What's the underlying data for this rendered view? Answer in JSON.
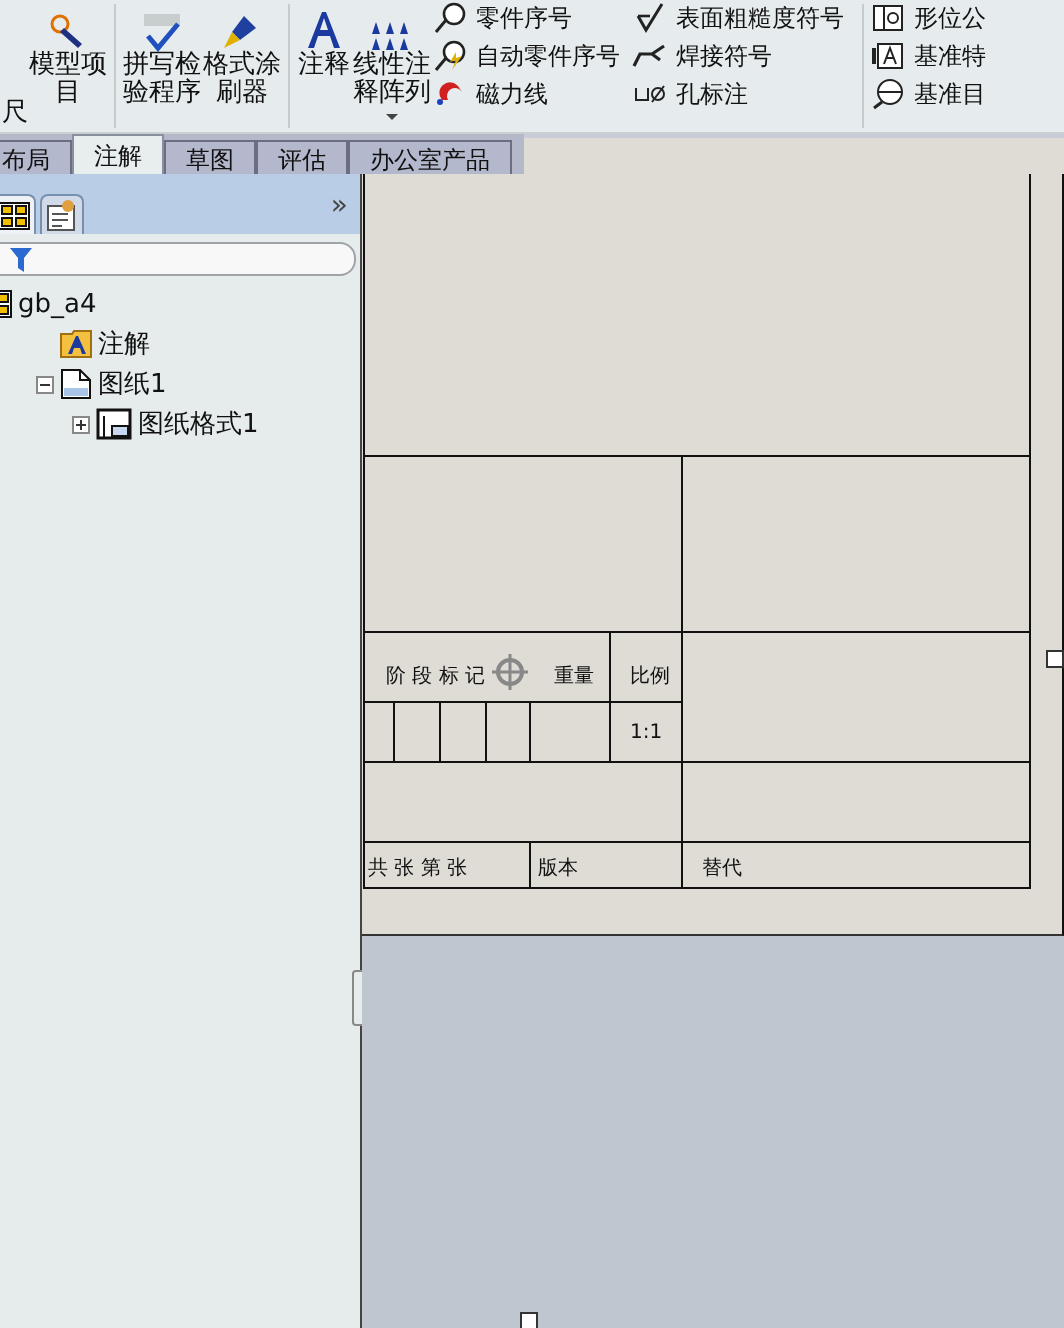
{
  "ribbon": [
    {
      "kind": "large",
      "label": "尺",
      "has_menu": false
    },
    {
      "kind": "large",
      "label": "模型项目",
      "has_menu": false
    },
    {
      "kind": "separator"
    },
    {
      "kind": "large",
      "label": "拼写检验程序",
      "has_menu": false
    },
    {
      "kind": "large",
      "label": "格式涂刷器",
      "has_menu": false
    },
    {
      "kind": "separator"
    },
    {
      "kind": "large",
      "label": "注释",
      "has_menu": false
    },
    {
      "kind": "large",
      "label": "线性注释阵列",
      "has_menu": true
    },
    {
      "kind": "column",
      "items": [
        {
          "label": "零件序号"
        },
        {
          "label": "自动零件序号"
        },
        {
          "label": "磁力线"
        }
      ]
    },
    {
      "kind": "column",
      "items": [
        {
          "label": "表面粗糙度符号"
        },
        {
          "label": "焊接符号"
        },
        {
          "label": "孔标注"
        }
      ]
    },
    {
      "kind": "separator"
    },
    {
      "kind": "column",
      "items": [
        {
          "label": "形位公"
        },
        {
          "label": "基准特"
        },
        {
          "label": "基准目"
        }
      ]
    }
  ],
  "tabs": [
    {
      "label": "布局",
      "selected": false
    },
    {
      "label": "注解",
      "selected": true
    },
    {
      "label": "草图",
      "selected": false
    },
    {
      "label": "评估",
      "selected": false
    },
    {
      "label": "办公室产品",
      "selected": false
    }
  ],
  "panel": {
    "more": "»",
    "tree": [
      {
        "label": "gb_a4",
        "kind": "drawing",
        "children": [
          {
            "label": "注解",
            "kind": "annotation"
          },
          {
            "label": "图纸1",
            "kind": "sheet",
            "expanded": true,
            "children": [
              {
                "label": "图纸格式1",
                "kind": "format",
                "expanded": false
              }
            ]
          }
        ]
      }
    ]
  },
  "title_block": {
    "stage_mark": "阶 段 标 记",
    "weight": "重量",
    "scale_label": "比例",
    "scale": "1:1",
    "sheets": "共 张 第 张",
    "version": "版本",
    "replaces": "替代"
  }
}
